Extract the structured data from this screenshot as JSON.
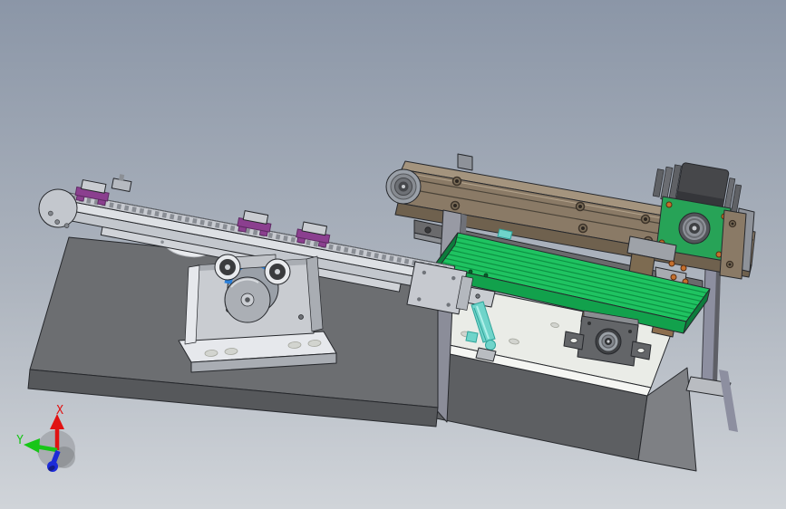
{
  "triad": {
    "x_label": "X",
    "y_label": "Y"
  },
  "colors": {
    "bg_top": "#8b96a7",
    "bg_mid": "#adb4be",
    "bg_bottom": "#d0d4d9",
    "edge": "#26282c",
    "base_top": "#6c6e71",
    "base_front": "#56585b",
    "sliver": "#8b8d99",
    "rb_front": "#5d5f62",
    "rb_side": "#7e8084",
    "w_plate": "#eaece7",
    "w_edge": "#f5f6f3",
    "slot": "#d2d4cf",
    "g_table": "#1fc361",
    "g_front": "#12a14c",
    "g_side": "#0d7c3c",
    "m_green": "#27a357",
    "b_brown": "#8a7a66",
    "b_light": "#a4947e",
    "b_dark": "#6f614e",
    "tan_dark": "#7d6b51",
    "rail_light": "#dde0e4",
    "rail_mid": "#c3c7cd",
    "rail_bar": "#d0d3d8",
    "holed": "#6a6a6c",
    "holed_light": "#8d9095",
    "stand_face": "#c9ccd1",
    "stand_side": "#a9adb3",
    "stand_bright": "#e6e8ec",
    "p_blue": "#2a7fd9",
    "p_gray": "#9aa0a8",
    "disc": "#abafb5",
    "hub": "#cbced3",
    "roller_w": "#e8eaed",
    "roller_d": "#3a3b3d",
    "cyan": "#6fd4ca",
    "cyan_dark": "#2fa399",
    "purple": "#8b3f8f",
    "purple_dark": "#5e2b63",
    "post_g": "#989aa4",
    "post_d": "#6f7178",
    "leg_g": "#8d8fa0",
    "leg_d": "#5e5f66",
    "foot_g": "#b9bcc1",
    "brown_b": "#8d6e4e",
    "copper": "#c4702e",
    "copper_dark": "#5a2d10",
    "motor": "#46474a",
    "motor_d": "#35363a",
    "fin": "#6b6d72",
    "fin_d": "#5f6165",
    "metal": "#8e9299",
    "metal_d": "#53555a",
    "white_guard": "#e9ebee",
    "l_bracket": "#a8abb1",
    "band": "#d9dcde",
    "band2": "#aeb2b8",
    "slate": "#9ea2a8",
    "axis_x": "#e11212",
    "axis_y": "#18c618",
    "axis_z": "#1c2bd8",
    "triad_shadow": "#85878b"
  }
}
